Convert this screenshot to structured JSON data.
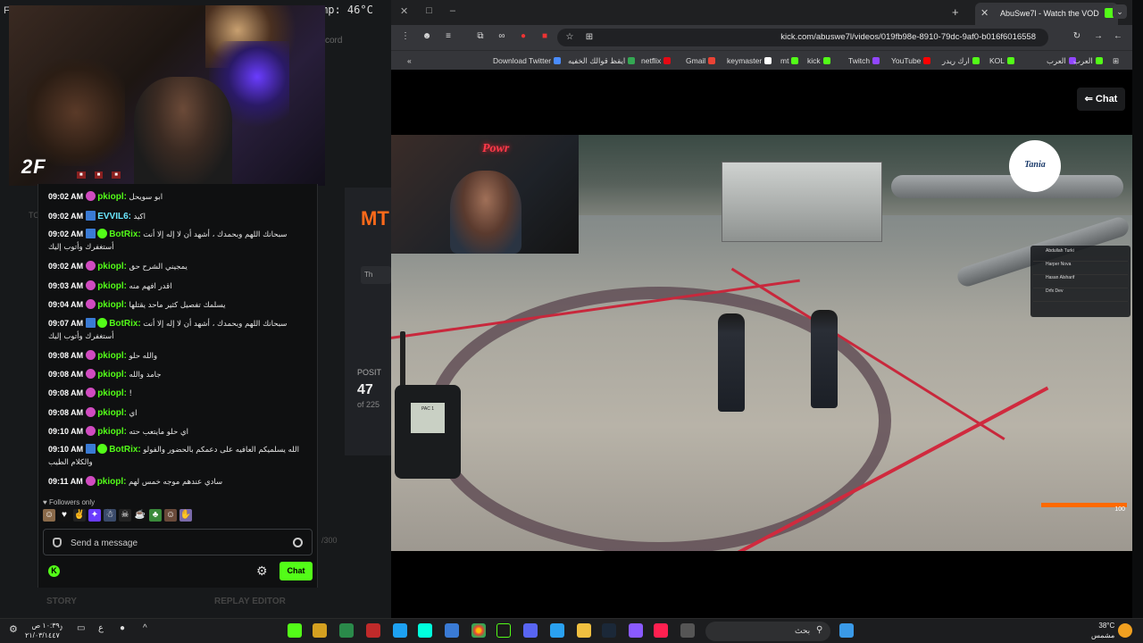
{
  "overlay": {
    "f_label": "F",
    "temp": "mp: 46°C",
    "cord": "cord",
    "cam_logo": "2F",
    "posit_label": "POSIT",
    "posit_value": "47",
    "posit_of": "of 225",
    "th_chip": "Th",
    "tc_label": "TO"
  },
  "chat": {
    "messages": [
      {
        "time": "09:02 AM",
        "badge": "pink",
        "user": "pkiopl:",
        "color": "green",
        "text": "ابو سويحل"
      },
      {
        "time": "09:02 AM",
        "badge": "blue",
        "user": "EVVIL6:",
        "color": "cyan",
        "text": "اكيد"
      },
      {
        "time": "09:02 AM",
        "badge": "bot",
        "user": "BotRix:",
        "color": "green",
        "text": "سبحانك اللهم وبحمدك ، أشهد أن لا إله إلا أنت أستغفرك وأتوب إليك"
      },
      {
        "time": "09:02 AM",
        "badge": "pink",
        "user": "pkiopl:",
        "color": "green",
        "text": "يمجيني الشرح حق"
      },
      {
        "time": "09:03 AM",
        "badge": "pink",
        "user": "pkiopl:",
        "color": "green",
        "text": "اقدر افهم منه"
      },
      {
        "time": "09:04 AM",
        "badge": "pink",
        "user": "pkiopl:",
        "color": "green",
        "text": "يسلمك تفصيل كثير ماحد يقتلها"
      },
      {
        "time": "09:07 AM",
        "badge": "bot",
        "user": "BotRix:",
        "color": "green",
        "text": "سبحانك اللهم وبحمدك ، أشهد أن لا إله إلا أنت أستغفرك وأتوب إليك"
      },
      {
        "time": "09:08 AM",
        "badge": "pink",
        "user": "pkiopl:",
        "color": "green",
        "text": "والله حلو"
      },
      {
        "time": "09:08 AM",
        "badge": "pink",
        "user": "pkiopl:",
        "color": "green",
        "text": "جامد والله"
      },
      {
        "time": "09:08 AM",
        "badge": "pink",
        "user": "pkiopl:",
        "color": "green",
        "text": "!"
      },
      {
        "time": "09:08 AM",
        "badge": "pink",
        "user": "pkiopl:",
        "color": "green",
        "text": "اي"
      },
      {
        "time": "09:10 AM",
        "badge": "pink",
        "user": "pkiopl:",
        "color": "green",
        "text": "اي حلو مايتعب حته"
      },
      {
        "time": "09:10 AM",
        "badge": "bot",
        "user": "BotRix:",
        "color": "green",
        "text": "الله يسلميكم العافيه على دعمكم بالحضور والفولو والكلام الطيب"
      },
      {
        "time": "09:11 AM",
        "badge": "pink",
        "user": "pkiopl:",
        "color": "green",
        "text": "سادي عندهم موجه خمس لهم"
      }
    ],
    "followers_only": "Followers only",
    "send_placeholder": "Send a message",
    "chat_button": "Chat",
    "story": "STORY",
    "replay_editor": "REPLAY EDITOR",
    "count": "/300"
  },
  "browser": {
    "tab_title": "AbuSwe7l - Watch the VOD",
    "url": "kick.com/abuswe7l/videos/019fb98e-8910-79dc-9af0-b016f6016558",
    "bookmarks": [
      {
        "label": "Download Twitter",
        "color": "#4a8cff"
      },
      {
        "label": "ايقظ قوالك الخفيه",
        "color": "#34a853"
      },
      {
        "label": "netflix",
        "color": "#e50914"
      },
      {
        "label": "Gmail",
        "color": "#ea4335"
      },
      {
        "label": "keymaster",
        "color": "#ffffff"
      },
      {
        "label": "mt",
        "color": "#53fc18"
      },
      {
        "label": "kick",
        "color": "#53fc18"
      },
      {
        "label": "Twitch",
        "color": "#9146ff"
      },
      {
        "label": "YouTube",
        "color": "#ff0000"
      },
      {
        "label": "ارك ريدر",
        "color": "#53fc18"
      },
      {
        "label": "KOL",
        "color": "#53fc18"
      },
      {
        "label": "العرب",
        "color": "#9146ff"
      },
      {
        "label": "العرب",
        "color": "#53fc18"
      }
    ],
    "chat_toggle": "Chat"
  },
  "game": {
    "neon": "Powr",
    "tania": "Tania",
    "hud_players": [
      "Abdullah Turki",
      "Harper Nova",
      "Hasan Alsharif",
      "Drfx Dev"
    ],
    "radio_screen": "PAC 1",
    "health": "100"
  },
  "taskbar": {
    "time": "١٠:٣٩ ص",
    "date": "٢١/٠٣/١٤٤٧",
    "lang": "ع",
    "search": "بحث",
    "weather_temp": "38°C",
    "weather_desc": "مشمس"
  }
}
